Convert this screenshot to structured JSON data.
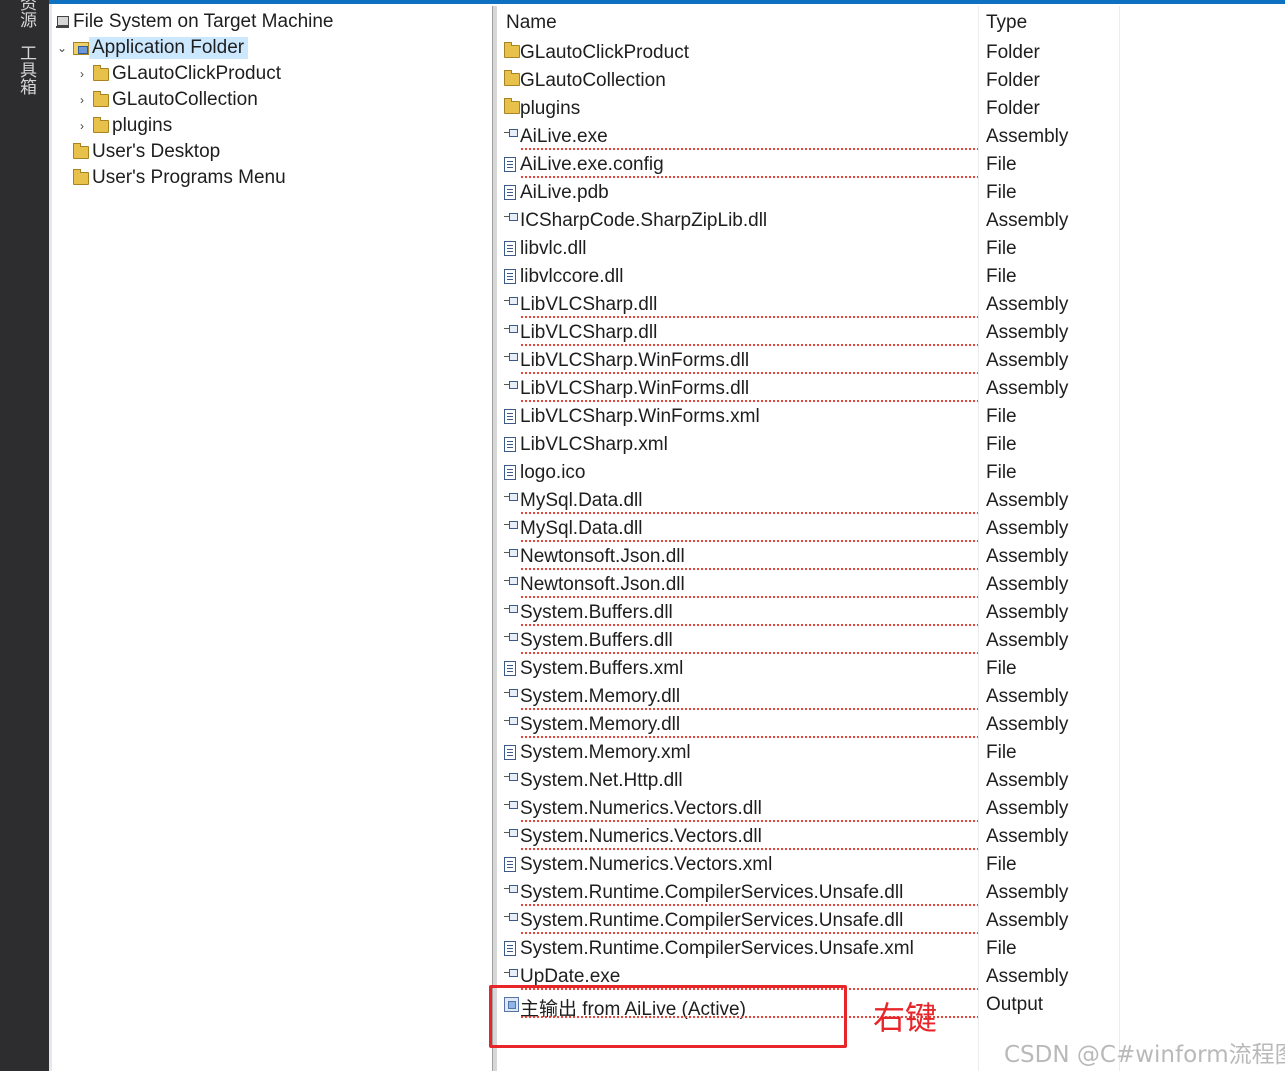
{
  "dock": {
    "tabs": [
      "资源",
      "工具箱"
    ]
  },
  "tree": {
    "root": {
      "label": "File System on Target Machine",
      "icon": "computer-icon"
    },
    "items": [
      {
        "label": "Application Folder",
        "icon": "open-folder-icon",
        "expanded": true,
        "selected": true,
        "level": 1
      },
      {
        "label": "GLautoClickProduct",
        "icon": "folder-icon",
        "level": 2,
        "expander": "›"
      },
      {
        "label": "GLautoCollection",
        "icon": "folder-icon",
        "level": 2,
        "expander": "›"
      },
      {
        "label": "plugins",
        "icon": "folder-icon",
        "level": 2,
        "expander": "›"
      },
      {
        "label": "User's Desktop",
        "icon": "folder-icon",
        "level": 1
      },
      {
        "label": "User's Programs Menu",
        "icon": "folder-icon",
        "level": 1
      }
    ],
    "expanded_glyph": "⌄"
  },
  "list": {
    "columns": {
      "name": "Name",
      "type": "Type"
    },
    "rows": [
      {
        "name": "GLautoClickProduct",
        "type": "Folder",
        "icon": "folder",
        "squiggle": false
      },
      {
        "name": "GLautoCollection",
        "type": "Folder",
        "icon": "folder",
        "squiggle": false
      },
      {
        "name": "plugins",
        "type": "Folder",
        "icon": "folder",
        "squiggle": false
      },
      {
        "name": "AiLive.exe",
        "type": "Assembly",
        "icon": "assembly",
        "squiggle": true
      },
      {
        "name": "AiLive.exe.config",
        "type": "File",
        "icon": "file",
        "squiggle": true
      },
      {
        "name": "AiLive.pdb",
        "type": "File",
        "icon": "file",
        "squiggle": false
      },
      {
        "name": "ICSharpCode.SharpZipLib.dll",
        "type": "Assembly",
        "icon": "assembly",
        "squiggle": false
      },
      {
        "name": "libvlc.dll",
        "type": "File",
        "icon": "file",
        "squiggle": false
      },
      {
        "name": "libvlccore.dll",
        "type": "File",
        "icon": "file",
        "squiggle": false
      },
      {
        "name": "LibVLCSharp.dll",
        "type": "Assembly",
        "icon": "assembly",
        "squiggle": true
      },
      {
        "name": "LibVLCSharp.dll",
        "type": "Assembly",
        "icon": "assembly",
        "squiggle": true
      },
      {
        "name": "LibVLCSharp.WinForms.dll",
        "type": "Assembly",
        "icon": "assembly",
        "squiggle": true
      },
      {
        "name": "LibVLCSharp.WinForms.dll",
        "type": "Assembly",
        "icon": "assembly",
        "squiggle": true
      },
      {
        "name": "LibVLCSharp.WinForms.xml",
        "type": "File",
        "icon": "file",
        "squiggle": false
      },
      {
        "name": "LibVLCSharp.xml",
        "type": "File",
        "icon": "file",
        "squiggle": false
      },
      {
        "name": "logo.ico",
        "type": "File",
        "icon": "file",
        "squiggle": false
      },
      {
        "name": "MySql.Data.dll",
        "type": "Assembly",
        "icon": "assembly",
        "squiggle": true
      },
      {
        "name": "MySql.Data.dll",
        "type": "Assembly",
        "icon": "assembly",
        "squiggle": true
      },
      {
        "name": "Newtonsoft.Json.dll",
        "type": "Assembly",
        "icon": "assembly",
        "squiggle": true
      },
      {
        "name": "Newtonsoft.Json.dll",
        "type": "Assembly",
        "icon": "assembly",
        "squiggle": true
      },
      {
        "name": "System.Buffers.dll",
        "type": "Assembly",
        "icon": "assembly",
        "squiggle": true
      },
      {
        "name": "System.Buffers.dll",
        "type": "Assembly",
        "icon": "assembly",
        "squiggle": true
      },
      {
        "name": "System.Buffers.xml",
        "type": "File",
        "icon": "file",
        "squiggle": false
      },
      {
        "name": "System.Memory.dll",
        "type": "Assembly",
        "icon": "assembly",
        "squiggle": true
      },
      {
        "name": "System.Memory.dll",
        "type": "Assembly",
        "icon": "assembly",
        "squiggle": true
      },
      {
        "name": "System.Memory.xml",
        "type": "File",
        "icon": "file",
        "squiggle": false
      },
      {
        "name": "System.Net.Http.dll",
        "type": "Assembly",
        "icon": "assembly",
        "squiggle": false
      },
      {
        "name": "System.Numerics.Vectors.dll",
        "type": "Assembly",
        "icon": "assembly",
        "squiggle": true
      },
      {
        "name": "System.Numerics.Vectors.dll",
        "type": "Assembly",
        "icon": "assembly",
        "squiggle": true
      },
      {
        "name": "System.Numerics.Vectors.xml",
        "type": "File",
        "icon": "file",
        "squiggle": false
      },
      {
        "name": "System.Runtime.CompilerServices.Unsafe.dll",
        "type": "Assembly",
        "icon": "assembly",
        "squiggle": true
      },
      {
        "name": "System.Runtime.CompilerServices.Unsafe.dll",
        "type": "Assembly",
        "icon": "assembly",
        "squiggle": true
      },
      {
        "name": "System.Runtime.CompilerServices.Unsafe.xml",
        "type": "File",
        "icon": "file",
        "squiggle": false
      },
      {
        "name": "UpDate.exe",
        "type": "Assembly",
        "icon": "assembly",
        "squiggle": true
      },
      {
        "name": "主输出 from AiLive (Active)",
        "type": "Output",
        "icon": "output",
        "squiggle": true
      }
    ]
  },
  "annotation": {
    "text": "右键",
    "color": "#e8262a"
  },
  "watermark": "CSDN @C#winform流程图",
  "colors": {
    "accent": "#0e70c0",
    "selection": "#cce8ff",
    "squiggle": "#e03c31"
  }
}
